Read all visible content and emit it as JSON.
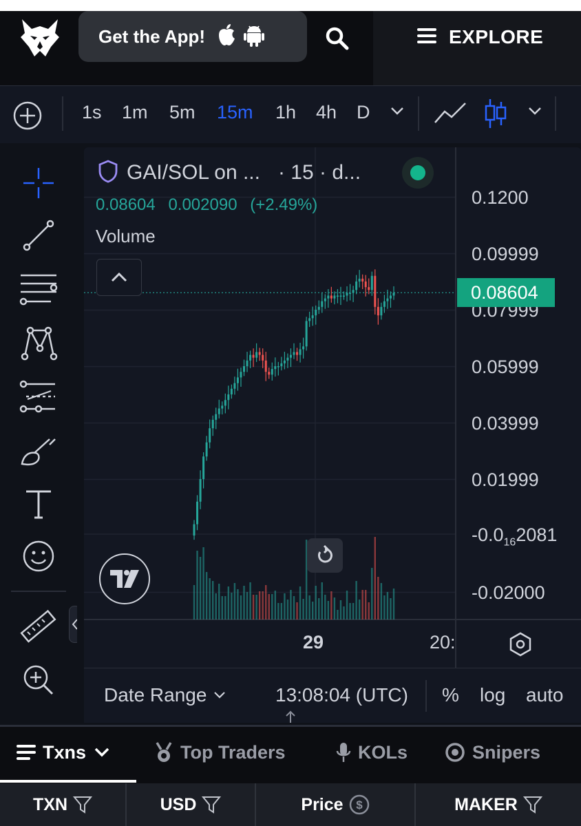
{
  "header": {
    "get_app_label": "Get the App!",
    "explore_label": "EXPLORE"
  },
  "toolbar": {
    "timeframes": [
      "1s",
      "1m",
      "5m",
      "15m",
      "1h",
      "4h",
      "D"
    ],
    "active_timeframe": "15m"
  },
  "legend": {
    "symbol": "GAI/SOL on ...",
    "interval": "· 15 · d...",
    "last_price": "0.08604",
    "change": "0.002090",
    "change_pct": "(+2.49%)",
    "volume_label": "Volume"
  },
  "price_axis": {
    "labels": [
      "0.1200",
      "0.09999",
      "0.07999",
      "0.05999",
      "0.03999",
      "0.01999",
      "-0.02000"
    ],
    "subscript_label": {
      "prefix": "-0.0",
      "sub": "16",
      "suffix": "2081"
    },
    "current_price_tag": "0.08604"
  },
  "time_axis": {
    "labels": [
      "29",
      "20:"
    ]
  },
  "chart_footer": {
    "date_range_label": "Date Range",
    "clock": "13:08:04 (UTC)",
    "percent_label": "%",
    "log_label": "log",
    "auto_label": "auto"
  },
  "tabs": [
    {
      "label": "Txns",
      "active": true
    },
    {
      "label": "Top Traders",
      "active": false
    },
    {
      "label": "KOLs",
      "active": false
    },
    {
      "label": "Snipers",
      "active": false
    }
  ],
  "table_header": {
    "txn": "TXN",
    "usd": "USD",
    "price": "Price",
    "maker": "MAKER"
  },
  "colors": {
    "up": "#26a69a",
    "down": "#ef5350",
    "accent": "#2962ff",
    "price_tag": "#14a37f"
  },
  "chart_data": {
    "type": "candlestick",
    "symbol": "GAI/SOL",
    "interval": "15",
    "ylim": [
      -0.03,
      0.13
    ],
    "y_ticks": [
      0.12,
      0.09999,
      0.07999,
      0.05999,
      0.03999,
      0.01999,
      -0.02
    ],
    "current_price": 0.08604,
    "close_series": [
      0.004,
      0.012,
      0.02,
      0.028,
      0.033,
      0.038,
      0.041,
      0.043,
      0.045,
      0.046,
      0.048,
      0.05,
      0.052,
      0.054,
      0.056,
      0.058,
      0.06,
      0.062,
      0.064,
      0.063,
      0.065,
      0.064,
      0.062,
      0.058,
      0.057,
      0.059,
      0.06,
      0.06,
      0.061,
      0.062,
      0.063,
      0.064,
      0.065,
      0.064,
      0.066,
      0.067,
      0.076,
      0.077,
      0.078,
      0.08,
      0.081,
      0.083,
      0.084,
      0.085,
      0.084,
      0.085,
      0.085,
      0.085,
      0.085,
      0.086,
      0.086,
      0.087,
      0.09,
      0.091,
      0.09,
      0.088,
      0.087,
      0.092,
      0.081,
      0.078,
      0.081,
      0.083,
      0.084,
      0.085,
      0.086
    ]
  }
}
